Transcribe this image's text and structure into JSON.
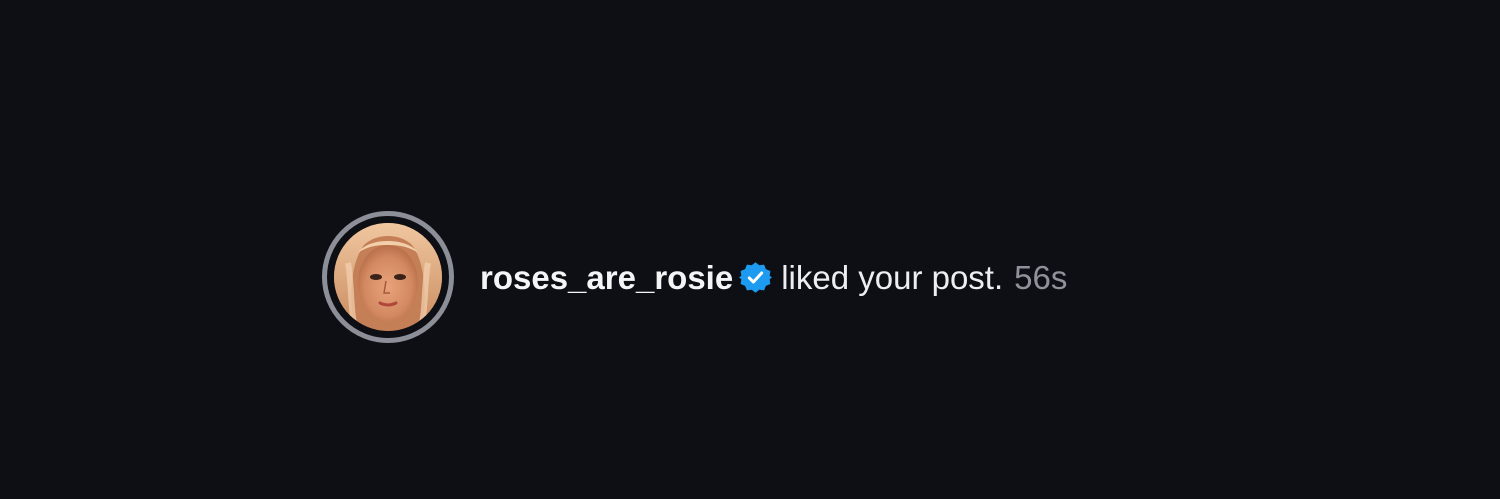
{
  "notification": {
    "username": "roses_are_rosie",
    "verified": true,
    "action": "liked your post.",
    "time": "56s"
  },
  "colors": {
    "background": "#0d0f14",
    "username": "#f4f5f7",
    "action": "#eceef1",
    "timestamp": "#8e929b",
    "verified_badge": "#1d9bf0",
    "avatar_ring": "#8c8f98"
  },
  "icons": {
    "verified": "verified-badge-icon"
  }
}
